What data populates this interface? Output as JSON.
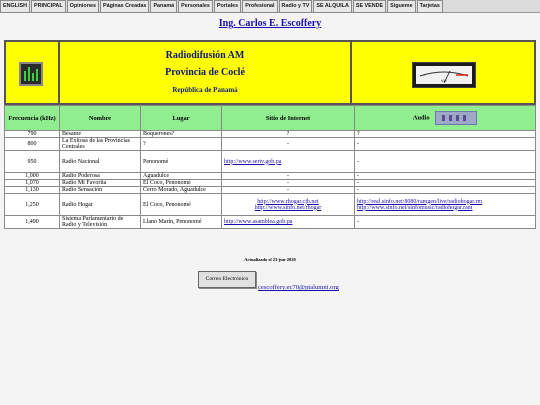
{
  "nav": [
    "ENGLISH",
    "PRINCIPAL",
    "Opiniones",
    "Páginas Creadas",
    "Panamá",
    "Personales",
    "Portales",
    "Profesional",
    "Radio y TV",
    "SE ALQUILA",
    "SE VENDE",
    "Sígueme",
    "Tarjetas"
  ],
  "page_title": "Ing. Carlos E. Escoffery",
  "banner": {
    "line1": "Radiodifusión AM",
    "line2": "Provincia de Coclé",
    "line3": "República de Panamá"
  },
  "table": {
    "headers": [
      "Frecuencia (kHz)",
      "Nombre",
      "Lugar",
      "Sitio de Internet",
      "Audio"
    ],
    "rows": [
      {
        "freq": "790",
        "name": "Bésame",
        "place": "Boquerones?",
        "site": "?",
        "audio": "?"
      },
      {
        "freq": "800",
        "name": "La Exitosa de las Provincias Centrales",
        "place": "?",
        "site": "-",
        "audio": "-"
      },
      {
        "freq": "950",
        "name": "Radio Nacional",
        "place": "Penonomé",
        "site": "http://www.sertv.gob.pa",
        "audio": "-"
      },
      {
        "freq": "1,000",
        "name": "Radio Poderosa",
        "place": "Aguadulce",
        "site": "-",
        "audio": "-"
      },
      {
        "freq": "1,070",
        "name": "Radio Mi Favorita",
        "place": "El Coco, Penonomé",
        "site": "-",
        "audio": "-"
      },
      {
        "freq": "1,130",
        "name": "Radio Sensación",
        "place": "Cerro Morado, Aguadulce",
        "site": "-",
        "audio": "-"
      },
      {
        "freq": "1,250",
        "name": "Radio Hogar",
        "place": "El Coco, Penonomé",
        "site": "http://www.rhogar.cjb.net",
        "site2": "http://www.sinfo.net/rhogar",
        "audio": "http://real.sinfo.net:8080/ramgen/live/radiohogar.rm",
        "audio2": "http://www.sinfo.net/sinfomusic/radiohogar.ram"
      },
      {
        "freq": "1,490",
        "name": "Sistema Parlamentario de Radio y Televisión",
        "place": "Llano Marín, Penonomé",
        "site": "http://www.asamblea.gob.pa",
        "audio": "-"
      }
    ]
  },
  "updated": "Actualizado el 23-jun-2020",
  "email_button": "Correo Electrónico",
  "email_link": "cescoffery.ec70@ptalumni.org"
}
